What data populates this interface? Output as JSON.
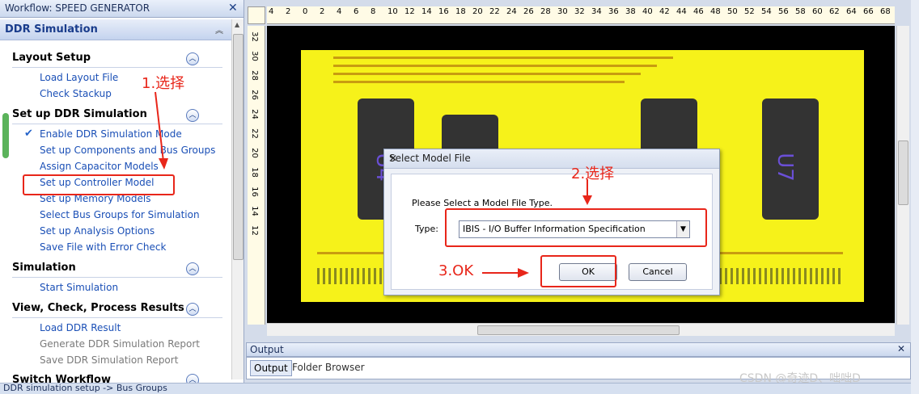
{
  "workflow": {
    "title": "Workflow: SPEED GENERATOR",
    "panel_title": "DDR Simulation",
    "sections": [
      {
        "label": "Layout Setup",
        "items": [
          {
            "label": "Load Layout File",
            "enabled": true
          },
          {
            "label": "Check Stackup",
            "enabled": true
          }
        ]
      },
      {
        "label": "Set up DDR Simulation",
        "items": [
          {
            "label": "Enable DDR Simulation Mode",
            "enabled": true,
            "checked": true
          },
          {
            "label": "Set up Components and Bus Groups",
            "enabled": true
          },
          {
            "label": "Assign Capacitor Models",
            "enabled": true
          },
          {
            "label": "Set up Controller Model",
            "enabled": true
          },
          {
            "label": "Set up Memory Models",
            "enabled": true
          },
          {
            "label": "Select Bus Groups for Simulation",
            "enabled": true
          },
          {
            "label": "Set up Analysis Options",
            "enabled": true
          },
          {
            "label": "Save File with Error Check",
            "enabled": true
          }
        ]
      },
      {
        "label": "Simulation",
        "items": [
          {
            "label": "Start Simulation",
            "enabled": true
          }
        ]
      },
      {
        "label": "View, Check, Process Results",
        "items": [
          {
            "label": "Load DDR Result",
            "enabled": true
          },
          {
            "label": "Generate DDR Simulation Report",
            "enabled": false
          },
          {
            "label": "Save DDR Simulation Report",
            "enabled": false
          }
        ]
      },
      {
        "label": "Switch Workflow",
        "items": []
      }
    ]
  },
  "annotations": {
    "step1": "1.选择",
    "step2": "2.选择",
    "step3": "3.OK"
  },
  "rulers": {
    "top": [
      "4",
      "2",
      "0",
      "2",
      "4",
      "6",
      "8",
      "10",
      "12",
      "14",
      "16",
      "18",
      "20",
      "22",
      "24",
      "26",
      "28",
      "30",
      "32",
      "34",
      "36",
      "38",
      "40",
      "42",
      "44",
      "46",
      "48",
      "50",
      "52",
      "54",
      "56",
      "58",
      "60",
      "62",
      "64",
      "66",
      "68"
    ],
    "left": [
      "32",
      "30",
      "28",
      "26",
      "24",
      "22",
      "20",
      "18",
      "16",
      "14",
      "12"
    ]
  },
  "pcb": {
    "labels": [
      "U4",
      "U7"
    ]
  },
  "dialog": {
    "title": "Select Model File",
    "prompt": "Please Select a Model File Type.",
    "type_label": "Type:",
    "type_value": "IBIS - I/O Buffer Information Specification",
    "ok": "OK",
    "cancel": "Cancel"
  },
  "output": {
    "title": "Output",
    "tabs": [
      "Output",
      "Folder Browser"
    ]
  },
  "status": "DDR simulation setup -> Bus Groups",
  "watermark": "CSDN @奇迹D、咄咄D",
  "colors": {
    "board": "#f6f21a",
    "link": "#1a4fb6",
    "annotation": "#e8261a",
    "pcb_background": "#000000"
  }
}
